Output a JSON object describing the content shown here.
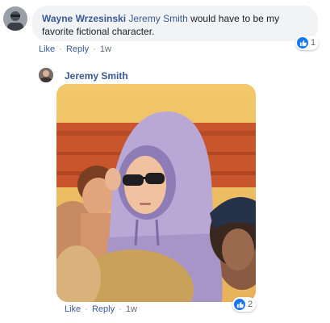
{
  "comment": {
    "author": "Wayne Wrzesinski",
    "mention": "Jeremy Smith",
    "text": " would have to be my favorite fictional character.",
    "reaction_count": "1",
    "actions": {
      "like": "Like",
      "reply": "Reply",
      "time": "1w",
      "separator": "·"
    }
  },
  "reply": {
    "author": "Jeremy Smith",
    "reaction_count": "2",
    "actions": {
      "like": "Like",
      "reply": "Reply",
      "time": "1w",
      "separator": "·"
    }
  },
  "icons": {
    "avatar_wayne": "user-avatar",
    "avatar_jeremy": "user-avatar",
    "reaction": "thumbs-up-icon",
    "photo": "gif-image"
  },
  "colors": {
    "link": "#385898",
    "bubble": "#f2f3f5",
    "like_blue": "#1877f2",
    "meta": "#606770"
  }
}
